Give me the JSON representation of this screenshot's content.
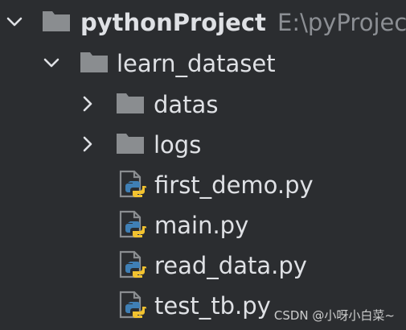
{
  "project": {
    "name": "pythonProject",
    "path": "E:\\pyProjec",
    "expanded": true,
    "icon": "folder-icon"
  },
  "tree": {
    "learn_dataset": {
      "name": "learn_dataset",
      "expanded": true,
      "icon": "folder-icon"
    },
    "datas": {
      "name": "datas",
      "expanded": false,
      "icon": "folder-icon"
    },
    "logs": {
      "name": "logs",
      "expanded": false,
      "icon": "folder-icon"
    },
    "files": [
      {
        "name": "first_demo.py",
        "icon": "python-file-icon"
      },
      {
        "name": "main.py",
        "icon": "python-file-icon"
      },
      {
        "name": "read_data.py",
        "icon": "python-file-icon"
      },
      {
        "name": "test_tb.py",
        "icon": "python-file-icon"
      }
    ]
  },
  "watermark": "CSDN @小呀小白菜~",
  "colors": {
    "background": "#2b2d30",
    "text": "#dfe1e5",
    "path": "#8c8f94",
    "folder": "#8a8d90",
    "python_blue": "#3f7fb5",
    "python_yellow": "#f2c230"
  }
}
